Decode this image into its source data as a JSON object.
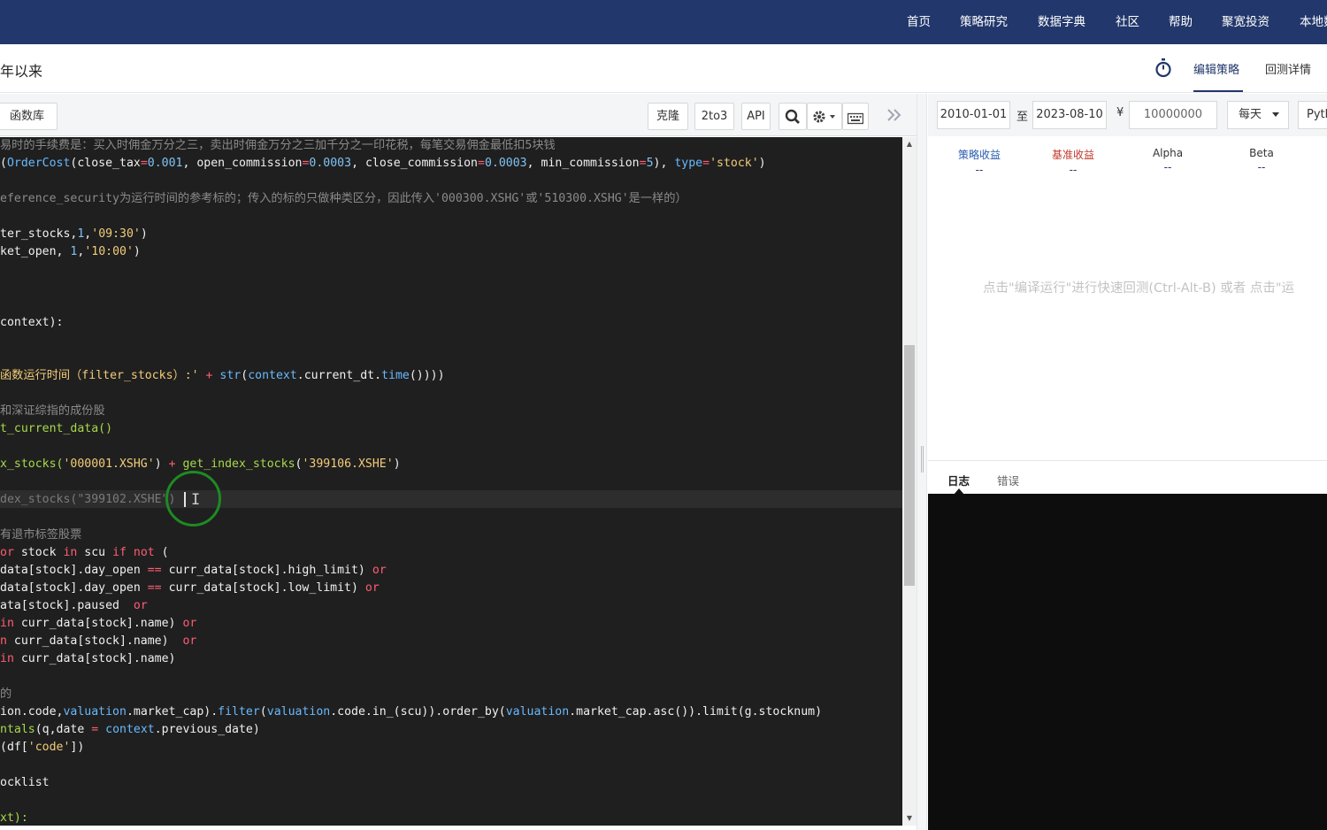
{
  "nav": {
    "items": [
      "首页",
      "策略研究",
      "数据字典",
      "社区",
      "帮助",
      "聚宽投资",
      "本地数"
    ]
  },
  "subheader": {
    "title": "年以来",
    "tab_edit": "编辑策略",
    "tab_detail": "回测详情"
  },
  "toolbar": {
    "library": "函数库",
    "clone": "克隆",
    "convert": "2to3",
    "api": "API",
    "search_icon": "search-icon",
    "settings_icon": "gear-icon",
    "keyboard_icon": "keyboard-icon",
    "collapse_icon": "double-chevron-right-icon"
  },
  "backtest": {
    "start_date": "2010-01-01",
    "to_label": "至",
    "end_date": "2023-08-10",
    "currency": "¥",
    "capital": "10000000",
    "frequency": "每天",
    "language": "Pyth"
  },
  "metrics": [
    {
      "label": "策略收益",
      "value": "--",
      "color": "#2a5db0"
    },
    {
      "label": "基准收益",
      "value": "--",
      "color": "#c0392b"
    },
    {
      "label": "Alpha",
      "value": "--",
      "color": "#333333"
    },
    {
      "label": "Beta",
      "value": "--",
      "color": "#333333"
    }
  ],
  "hint": "点击\"编译运行\"进行快速回测(Ctrl-Alt-B) 或者 点击\"运",
  "log": {
    "tab_log": "日志",
    "tab_error": "错误"
  },
  "code": {
    "l1": "易时的手续费是：买入时佣金万分之三，卖出时佣金万分之三加千分之一印花税，每笔交易佣金最低扣5块钱",
    "l2a": "(",
    "l2b": "OrderCost",
    "l2c": "(close_tax",
    "l2d": "=",
    "l2e": "0.001",
    "l2f": ", open_commission",
    "l2g": "=",
    "l2h": "0.0003",
    "l2i": ", close_commission",
    "l2j": "=",
    "l2k": "0.0003",
    "l2l": ", min_commission",
    "l2m": "=",
    "l2n": "5",
    "l2o": "), ",
    "l2p": "type",
    "l2q": "=",
    "l2r": "'stock'",
    "l2s": ")",
    "l3": "eference_security为运行时间的参考标的；传入的标的只做种类区分，因此传入'000300.XSHG'或'510300.XSHG'是一样的）",
    "l4a": "ter_stocks,",
    "l4b": "1",
    "l4c": ",",
    "l4d": "'09:30'",
    "l4e": ")",
    "l5a": "ket_open, ",
    "l5b": "1",
    "l5c": ",",
    "l5d": "'10:00'",
    "l5e": ")",
    "l6": "context):",
    "l7a": "函数运行时间（filter_stocks）:'",
    "l7b": " + ",
    "l7c": "str",
    "l7d": "(",
    "l7e": "context",
    "l7f": ".current_dt.",
    "l7g": "time",
    "l7h": "()))) ",
    "l8": "和深证综指的成份股",
    "l9": "t_current_data()",
    "l10a": "x_stocks(",
    "l10b": "'000001.XSHG'",
    "l10c": ") ",
    "l10d": "+",
    "l10e": " get_index_stocks",
    "l10f": "(",
    "l10g": "'399106.XSHE'",
    "l10h": ")",
    "l11": "dex_stocks(\"399102.XSHE\")",
    "l12": "有退市标签股票",
    "l13a": "or",
    "l13b": " stock ",
    "l13c": "in",
    "l13d": " scu ",
    "l13e": "if not",
    "l13f": " (",
    "l14a": "data[stock].day_open ",
    "l14b": "==",
    "l14c": " curr_data[stock].high_limit) ",
    "l14d": "or",
    "l15a": "data[stock].day_open ",
    "l15b": "==",
    "l15c": " curr_data[stock].low_limit) ",
    "l15d": "or",
    "l16a": "ata[stock].paused  ",
    "l16b": "or",
    "l17a": "in",
    "l17b": " curr_data[stock].name) ",
    "l17c": "or",
    "l18a": "n",
    "l18b": " curr_data[stock].name)  ",
    "l18c": "or",
    "l19a": "in",
    "l19b": " curr_data[stock].name)",
    "l20": "的",
    "l21a": "ion.code,",
    "l21b": "valuation",
    "l21c": ".market_cap).",
    "l21d": "filter",
    "l21e": "(",
    "l21f": "valuation",
    "l21g": ".code.in_(scu)).order_by(",
    "l21h": "valuation",
    "l21i": ".market_cap.asc()).limit(g.stocknum)",
    "l22a": "ntals",
    "l22b": "(q,date ",
    "l22c": "=",
    "l22d": " context",
    "l22e": ".previous_date)",
    "l23a": "(df[",
    "l23b": "'code'",
    "l23c": "])",
    "l24": "ocklist",
    "l25": "xt):"
  }
}
